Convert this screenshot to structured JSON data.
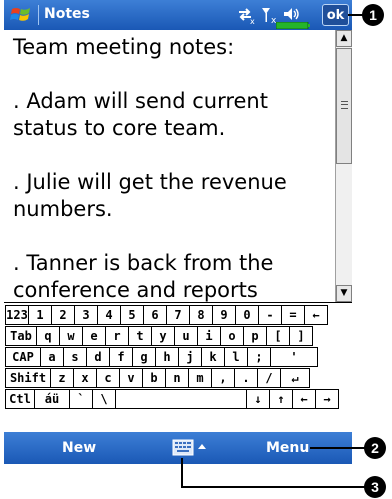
{
  "titlebar": {
    "title": "Notes",
    "ok_label": "ok",
    "icons": [
      "windows-start-flag-icon",
      "connectivity-icon",
      "signal-icon",
      "volume-icon",
      "battery-icon"
    ]
  },
  "document": {
    "paragraphs": [
      "Team meeting notes:",
      ". Adam will send current status to core team.",
      ". Julie will get the revenue numbers.",
      ". Tanner is back from the conference and reports"
    ]
  },
  "keyboard": {
    "rows": [
      [
        "123",
        "1",
        "2",
        "3",
        "4",
        "5",
        "6",
        "7",
        "8",
        "9",
        "0",
        "-",
        "=",
        "←"
      ],
      [
        "Tab",
        "q",
        "w",
        "e",
        "r",
        "t",
        "y",
        "u",
        "i",
        "o",
        "p",
        "[",
        "]"
      ],
      [
        "CAP",
        "a",
        "s",
        "d",
        "f",
        "g",
        "h",
        "j",
        "k",
        "l",
        ";",
        "'"
      ],
      [
        "Shift",
        "z",
        "x",
        "c",
        "v",
        "b",
        "n",
        "m",
        ",",
        ".",
        "/",
        "↵"
      ],
      [
        "Ctl",
        "áü",
        "`",
        "\\",
        " ",
        "↓",
        "↑",
        "←",
        "→"
      ]
    ]
  },
  "menubar": {
    "left_label": "New",
    "right_label": "Menu",
    "sip_icon": "keyboard-input-icon"
  },
  "callouts": [
    "1",
    "2",
    "3"
  ],
  "colors": {
    "bar_blue": "#2a66c4",
    "callout_black": "#000000"
  }
}
